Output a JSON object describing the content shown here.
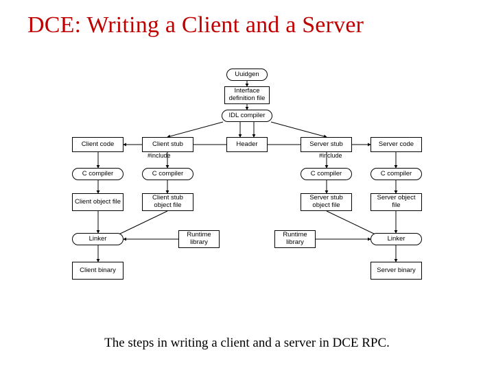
{
  "title": "DCE: Writing a Client and a Server",
  "caption": "The steps in writing a client and a server in DCE RPC.",
  "nodes": {
    "uuidgen": "Uuidgen",
    "idf": "Interface\ndefinition file",
    "idlcomp": "IDL compiler",
    "clientcode": "Client code",
    "clientstub": "Client stub",
    "header": "Header",
    "serverstub": "Server stub",
    "servercode": "Server code",
    "cc1": "C compiler",
    "cc2": "C compiler",
    "cc3": "C compiler",
    "cc4": "C compiler",
    "co": "Client\nobject file",
    "cso": "Client stub\nobject file",
    "sso": "Server stub\nobject file",
    "so": "Server\nobject file",
    "linkerL": "Linker",
    "rtL": "Runtime\nlibrary",
    "rtR": "Runtime\nlibrary",
    "linkerR": "Linker",
    "cbin": "Client\nbinary",
    "sbin": "Server\nbinary"
  },
  "labels": {
    "includeL": "#include",
    "includeR": "#include"
  }
}
